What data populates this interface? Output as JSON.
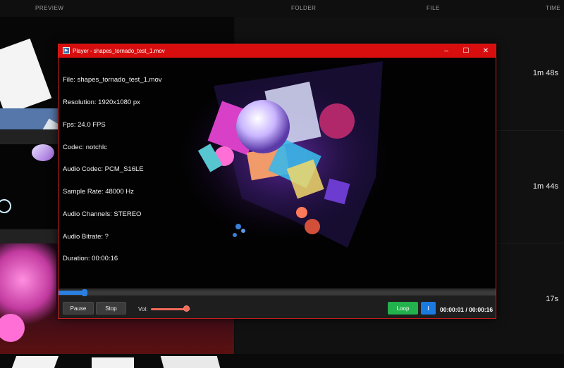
{
  "header": {
    "columns": [
      "PREVIEW",
      "FOLDER",
      "FILE",
      "TIME"
    ]
  },
  "rows": [
    {
      "time": "1m 48s"
    },
    {
      "time": "1m 44s"
    },
    {
      "time": "17s"
    }
  ],
  "player": {
    "title": "Player - shapes_tornado_test_1.mov",
    "icons": {
      "app": "app-icon",
      "minimize": "minimize-icon",
      "maximize": "maximize-icon",
      "close": "close-icon"
    },
    "glyphs": {
      "minimize": "–",
      "maximize": "☐",
      "close": "✕"
    },
    "info_lines": [
      "File: shapes_tornado_test_1.mov",
      "Resolution: 1920x1080 px",
      "Fps: 24.0 FPS",
      "Codec: notchlc",
      "Audio Codec: PCM_S16LE",
      "Sample Rate: 48000 Hz",
      "Audio Channels: STEREO",
      "Audio Bitrate: ?",
      "Duration: 00:00:16"
    ],
    "progress_fraction": 0.0625,
    "controls": {
      "pause": "Pause",
      "stop": "Stop",
      "volume_label": "Vol:",
      "volume_fraction": 0.9,
      "loop": "Loop",
      "info": "i",
      "timecode": "00:00:01 / 00:00:16"
    },
    "colors": {
      "titlebar": "#d80e0e",
      "loop": "#22b14c",
      "info": "#1a7ae0",
      "seek": "#2a7fe0",
      "volume": "#f06a5a"
    }
  }
}
